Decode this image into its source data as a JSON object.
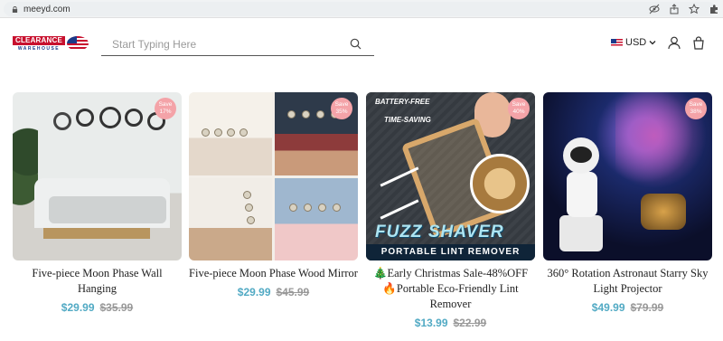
{
  "browser": {
    "url": "meeyd.com",
    "icons": [
      "lock-icon",
      "eye-off-icon",
      "share-icon",
      "star-icon",
      "extension-icon"
    ]
  },
  "header": {
    "logo_text": "CLEARANCE",
    "logo_subtext": "WAREHOUSE",
    "search_placeholder": "Start Typing Here",
    "currency": "USD",
    "icons": [
      "search-icon",
      "us-flag-icon",
      "chevron-down-icon",
      "user-icon",
      "shopping-bag-icon"
    ]
  },
  "products": [
    {
      "badge_line1": "Save",
      "badge_line2": "17%",
      "title": "Five-piece Moon Phase Wall Hanging",
      "price": "$29.99",
      "original_price": "$35.99"
    },
    {
      "badge_line1": "Save",
      "badge_line2": "35%",
      "title": "Five-piece Moon Phase Wood Mirror",
      "price": "$29.99",
      "original_price": "$45.99"
    },
    {
      "badge_line1": "Save",
      "badge_line2": "40%",
      "title_line1": "🎄Early Christmas Sale-48%OFF",
      "title_line2": "🔥Portable Eco-Friendly Lint Remover",
      "image_text": {
        "feature1": "BATTERY-FREE",
        "feature2": "TIME-SAVING",
        "headline": "FUZZ SHAVER",
        "subline": "PORTABLE LINT REMOVER"
      },
      "price": "$13.99",
      "original_price": "$22.99"
    },
    {
      "badge_line1": "Save",
      "badge_line2": "38%",
      "title": "360° Rotation Astronaut Starry Sky Light Projector",
      "price": "$49.99",
      "original_price": "$79.99"
    }
  ],
  "colors": {
    "sale_price": "#52aac4",
    "badge": "#f4a3a8",
    "logo_red": "#c8102e",
    "logo_blue": "#1b3a8a"
  }
}
